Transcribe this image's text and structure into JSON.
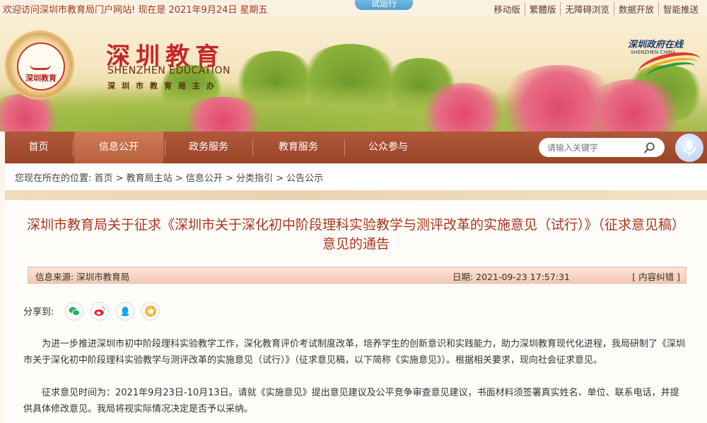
{
  "topbar": {
    "welcome": "欢迎访问深圳市教育局门户网站! 现在是 2021年9月24日 星期五",
    "trial": "试运行",
    "links": [
      "移动版",
      "繁體版",
      "无障碍浏览",
      "数据开放",
      "智能推送"
    ]
  },
  "header": {
    "seal_text": "深圳教育",
    "logo_cn": "深圳教育",
    "logo_en": "SHENZHEN EDUCATION",
    "logo_sub": "深圳市教育局主办",
    "gov_cn": "深圳政府在线",
    "gov_en": "SHENZHEN CHINA"
  },
  "nav": {
    "items": [
      "首页",
      "信息公开",
      "政务服务",
      "教育服务",
      "公众参与"
    ],
    "active_index": 1,
    "search_placeholder": "请输入关键字"
  },
  "breadcrumb": "您现在所在的位置: 首页 > 教育局主站 > 信息公开 > 分类指引 > 公告公示",
  "article": {
    "title_line1": "深圳市教育局关于征求《深圳市关于深化初中阶段理科实验教学与测评改革的实施意见（试行）》（征求意见稿）",
    "title_line2": "意见的通告",
    "source": "信息来源:  深圳市教育局",
    "date": "日期:  2021-09-23 17:57:31",
    "error_link": "[ 内容纠错 ]",
    "share_label": "分享到:",
    "paragraphs": [
      "为进一步推进深圳市初中阶段理科实验教学工作，深化教育评价考试制度改革，培养学生的创新意识和实践能力，助力深圳教育现代化进程，我局研制了《深圳市关于深化初中阶段理科实验教学与测评改革的实施意见（试行）》（征求意见稿，以下简称《实施意见》）。根据相关要求，现向社会征求意见。",
      "征求意见时间为：2021年9月23日-10月13日。请就《实施意见》提出意见建议及公平竞争审查意见建议，书面材料须签署真实姓名、单位、联系电话，并提供具体修改意见。我局将视实际情况决定是否予以采纳。"
    ]
  },
  "colors": {
    "accent": "#a8361a",
    "nav": "#9a4528",
    "nav_active": "#c06a48"
  }
}
